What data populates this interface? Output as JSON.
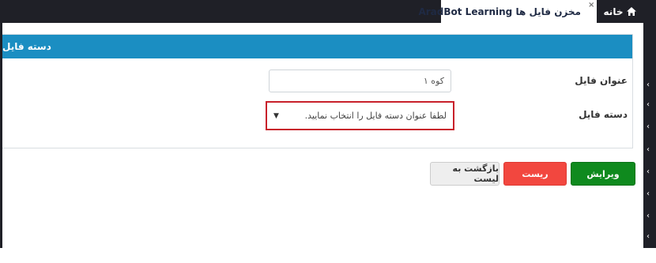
{
  "tabs": {
    "home_label": "خانه",
    "active_label": "مخزن فایل ها AradBot Learning",
    "close_glyph": "×"
  },
  "panel": {
    "title": "دسته فایل",
    "fields": {
      "title_label": "عنوان فایل",
      "title_value": "کوه ۱",
      "category_label": "دسته فایل",
      "category_placeholder": "لطفا عنوان دسته فایل را انتخاب نمایید."
    }
  },
  "buttons": {
    "edit": "ویرایش",
    "reset": "ریست",
    "back": "بازگشت به لیست"
  },
  "colors": {
    "header_bg": "#1f2027",
    "panel_header": "#1b8ec2",
    "edit_button": "#0f8a1e",
    "reset_button": "#f2473f",
    "highlight_border": "#c8212b"
  },
  "icons": {
    "home": "home-icon",
    "users": "users-icon",
    "sidebar_arrows": "chevron-left-icon"
  }
}
